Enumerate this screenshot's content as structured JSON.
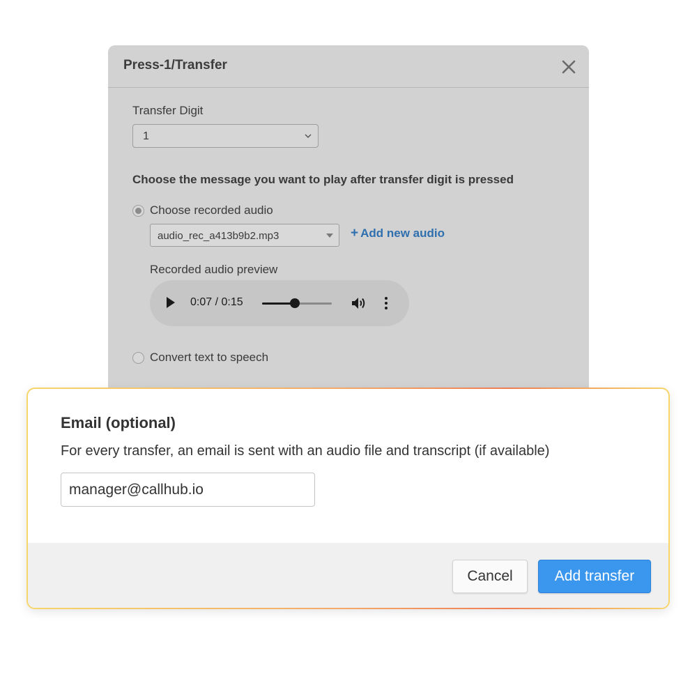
{
  "dialog": {
    "title": "Press-1/Transfer",
    "close_icon": "close-icon"
  },
  "transfer_digit": {
    "label": "Transfer Digit",
    "value": "1"
  },
  "message": {
    "heading": "Choose the message you want to play after transfer digit is pressed",
    "options": [
      {
        "label": "Choose recorded audio",
        "selected": true
      },
      {
        "label": "Convert text to speech",
        "selected": false
      }
    ],
    "audio_file": "audio_rec_a413b9b2.mp3",
    "add_audio_label": "Add new audio",
    "add_audio_icon": "plus-icon",
    "preview_label": "Recorded audio preview"
  },
  "player": {
    "time": "0:07 / 0:15",
    "progress": 0.47,
    "icons": [
      "play-icon",
      "volume-icon",
      "more-vertical-icon"
    ]
  },
  "email": {
    "heading": "Email (optional)",
    "description": "For every transfer, an email is sent with an audio file and transcript (if available)",
    "value": "manager@callhub.io"
  },
  "footer": {
    "cancel_label": "Cancel",
    "add_label": "Add transfer"
  },
  "colors": {
    "accent": "#3b96ee",
    "link": "#2f6fae",
    "highlight_border": "#f3a86a"
  }
}
